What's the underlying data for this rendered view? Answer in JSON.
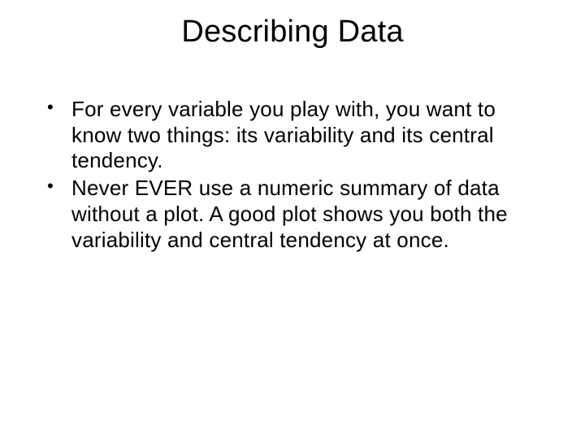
{
  "slide": {
    "title": "Describing Data",
    "bullets": [
      "For every variable you play with, you want to know two things: its variability and its central tendency.",
      "Never EVER use a numeric summary of data without a plot.  A good plot shows you both the variability and central tendency at once."
    ]
  }
}
